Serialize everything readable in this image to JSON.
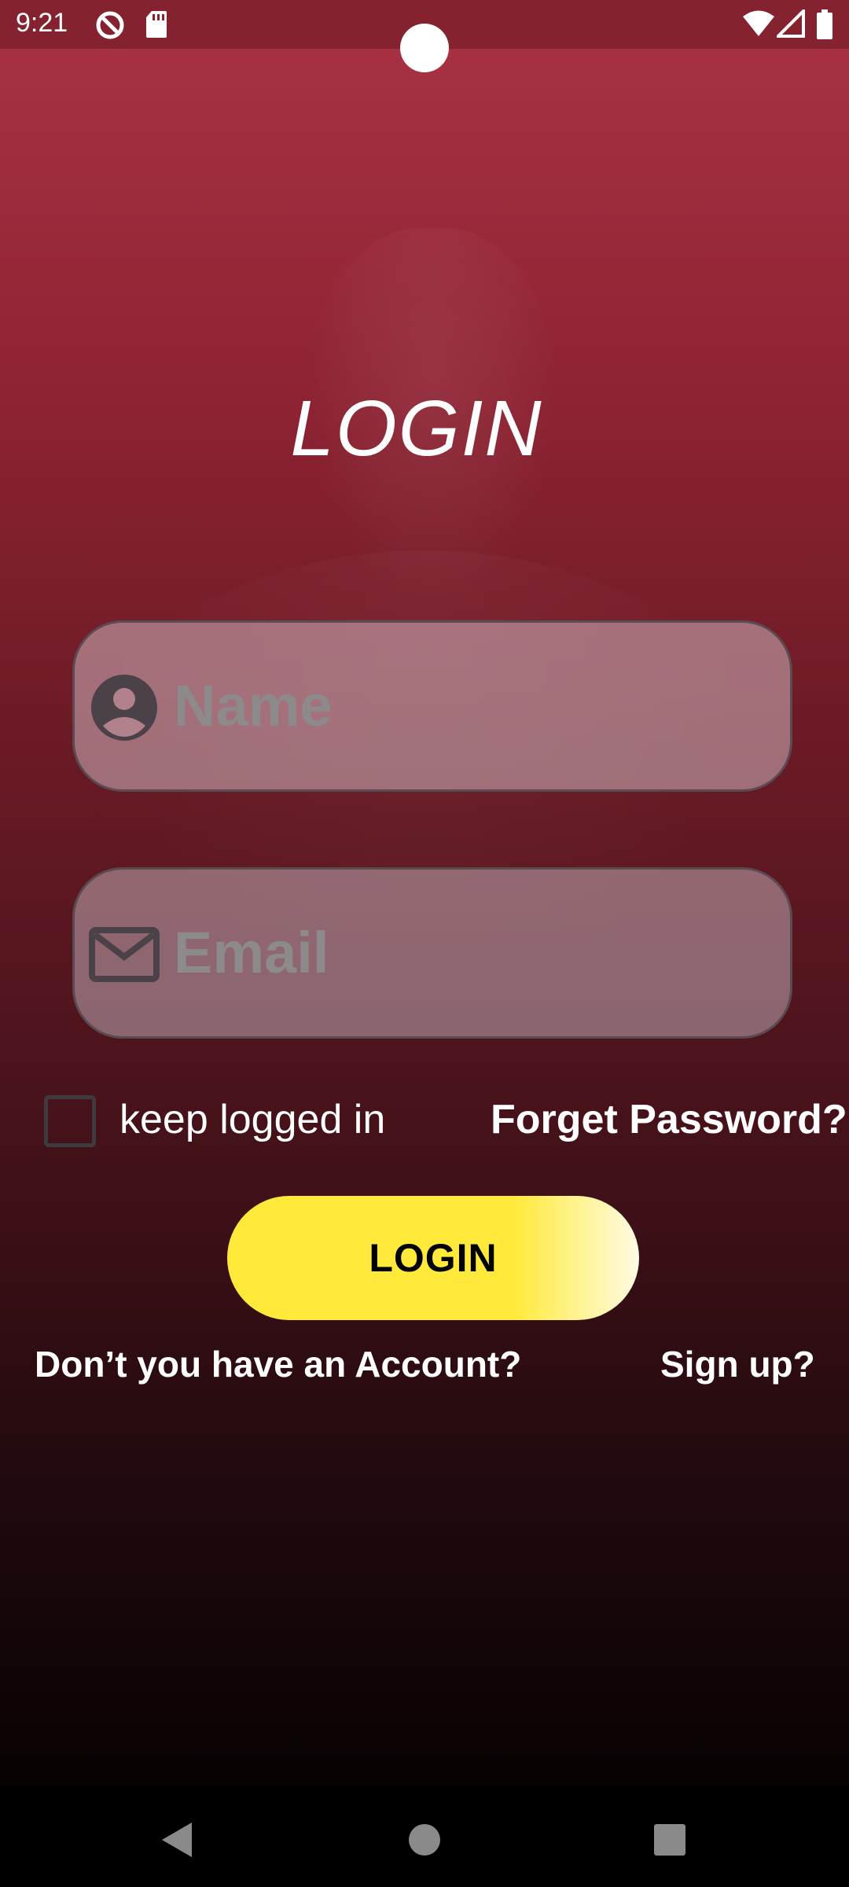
{
  "status_bar": {
    "time": "9:21",
    "left_icons": [
      "do-not-disturb-icon",
      "sd-card-icon"
    ],
    "right_icons": [
      "wifi-icon",
      "cellular-signal-icon",
      "battery-icon"
    ]
  },
  "login": {
    "title": "LOGIN",
    "name_field": {
      "placeholder": "Name",
      "value": "",
      "icon": "person-icon"
    },
    "email_field": {
      "placeholder": "Email",
      "value": "",
      "icon": "mail-icon"
    },
    "keep_logged_in": {
      "label": "keep logged in",
      "checked": false
    },
    "forget_password_label": "Forget Password?",
    "login_button_label": "LOGIN",
    "no_account_text": "Don’t you  have an Account?",
    "signup_label": "Sign up?"
  },
  "nav_bar": {
    "buttons": [
      "back-icon",
      "home-icon",
      "recents-icon"
    ]
  },
  "colors": {
    "gradient_top": "#aa3345",
    "gradient_bottom": "#000000",
    "button_yellow": "#ffea3c",
    "text": "#ffffff",
    "placeholder": "#8d8a8c"
  }
}
